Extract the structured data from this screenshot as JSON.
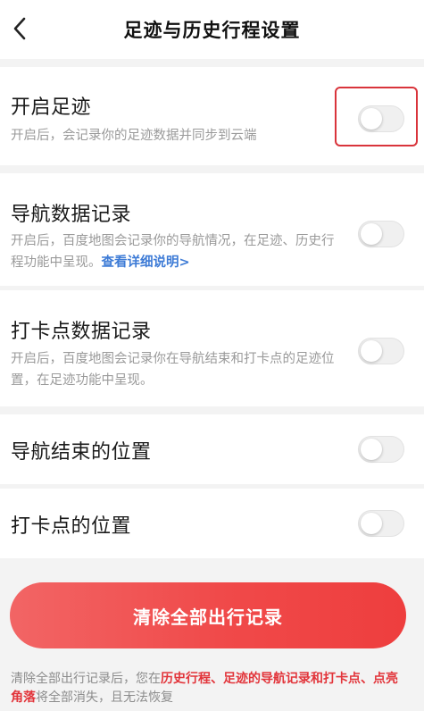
{
  "header": {
    "title": "足迹与历史行程设置",
    "back_icon": "chevron-left-icon"
  },
  "settings": [
    {
      "title": "开启足迹",
      "desc": "开启后，会记录你的足迹数据并同步到云端",
      "enabled": false
    },
    {
      "title": "导航数据记录",
      "desc": "开启后，百度地图会记录你的导航情况，在足迹、历史行程功能中呈现。",
      "link": "查看详细说明>",
      "enabled": false
    },
    {
      "title": "打卡点数据记录",
      "desc": "开启后，百度地图会记录你在导航结束和打卡点的足迹位置，在足迹功能中呈现。",
      "enabled": false
    },
    {
      "title": "导航结束的位置",
      "enabled": false
    },
    {
      "title": "打卡点的位置",
      "enabled": false
    }
  ],
  "clear_button": {
    "label": "清除全部出行记录"
  },
  "footer": {
    "part1": "清除全部出行记录后，您在",
    "highlight": "历史行程、足迹的导航记录和打卡点、点亮角落",
    "part2": "将全部消失，且无法恢复"
  },
  "colors": {
    "accent_red": "#ee3e3e",
    "link_blue": "#3d7bd6",
    "highlight_red": "#e2343a"
  }
}
